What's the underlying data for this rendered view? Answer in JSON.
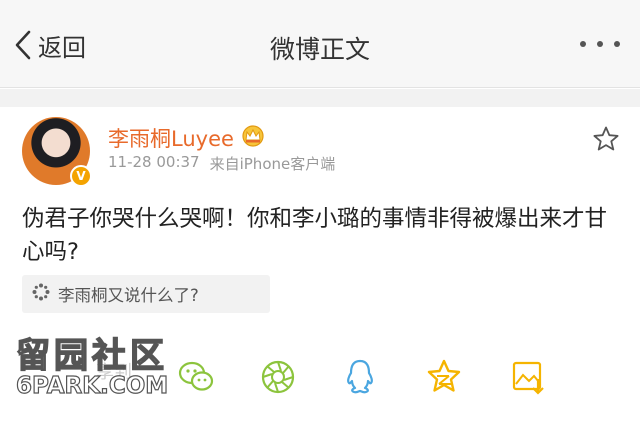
{
  "nav": {
    "back_label": "返回",
    "title": "微博正文"
  },
  "post": {
    "username": "李雨桐Luyee",
    "verified_mark": "V",
    "time": "11-28 00:37",
    "source": "来自iPhone客户端",
    "content": "伪君子你哭什么哭啊！你和李小璐的事情非得被爆出来才甘心吗?",
    "topic": "李雨桐又说什么了?"
  },
  "share_icons": [
    "wechat-icon",
    "moments-icon",
    "qq-icon",
    "qzone-icon",
    "save-image-icon"
  ],
  "watermark": {
    "cn": "留园社区",
    "en": "6PARK.COM",
    "faded": "享到"
  },
  "colors": {
    "username": "#e86a2b",
    "verified": "#f4a300",
    "share_green": "#8cc43d",
    "share_blue": "#4aa6e0",
    "share_yellow": "#f5b400"
  }
}
